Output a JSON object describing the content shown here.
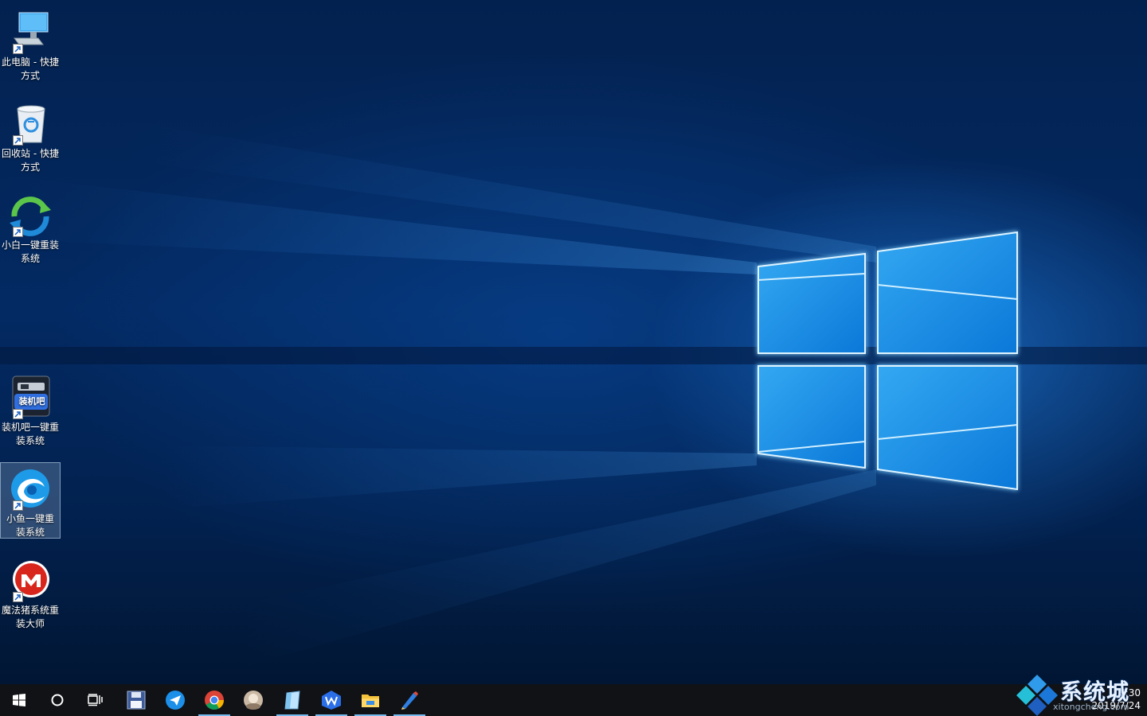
{
  "desktop": {
    "icons": [
      {
        "label": "此电脑 - 快捷方式",
        "icon": "this-pc-icon"
      },
      {
        "label": "回收站 - 快捷方式",
        "icon": "recycle-bin-icon"
      },
      {
        "label": "小白一键重装系统",
        "icon": "xiaobai-reinstall-icon"
      },
      {
        "label": "装机吧一键重装系统",
        "icon": "zhuangjiba-reinstall-icon",
        "badge": "装机吧"
      },
      {
        "label": "小鱼一键重装系统",
        "icon": "xiaoyu-reinstall-icon"
      },
      {
        "label": "魔法猪系统重装大师",
        "icon": "mofazhu-reinstall-icon"
      }
    ]
  },
  "taskbar": {
    "buttons": [
      {
        "name": "start",
        "icon": "windows-start-icon"
      },
      {
        "name": "search",
        "icon": "search-circle-icon"
      },
      {
        "name": "task-view",
        "icon": "task-view-icon"
      },
      {
        "name": "save-app",
        "icon": "floppy-disk-icon"
      },
      {
        "name": "feishu-app",
        "icon": "paper-plane-icon"
      },
      {
        "name": "chrome",
        "icon": "chrome-icon"
      },
      {
        "name": "photo-app",
        "icon": "photo-icon"
      },
      {
        "name": "notes-app",
        "icon": "notepad-icon"
      },
      {
        "name": "wps-app",
        "icon": "wps-icon"
      },
      {
        "name": "file-explorer",
        "icon": "folder-icon"
      },
      {
        "name": "paint-app",
        "icon": "pen-icon"
      }
    ],
    "clock": {
      "time": "16:30",
      "date": "2019/7/24"
    }
  },
  "watermark": {
    "text": "系统城",
    "subtext": "xitongcheng.com"
  },
  "colors": {
    "taskbar": "#101216",
    "accent": "#76b9ed",
    "wallpaper": "#03214f"
  }
}
